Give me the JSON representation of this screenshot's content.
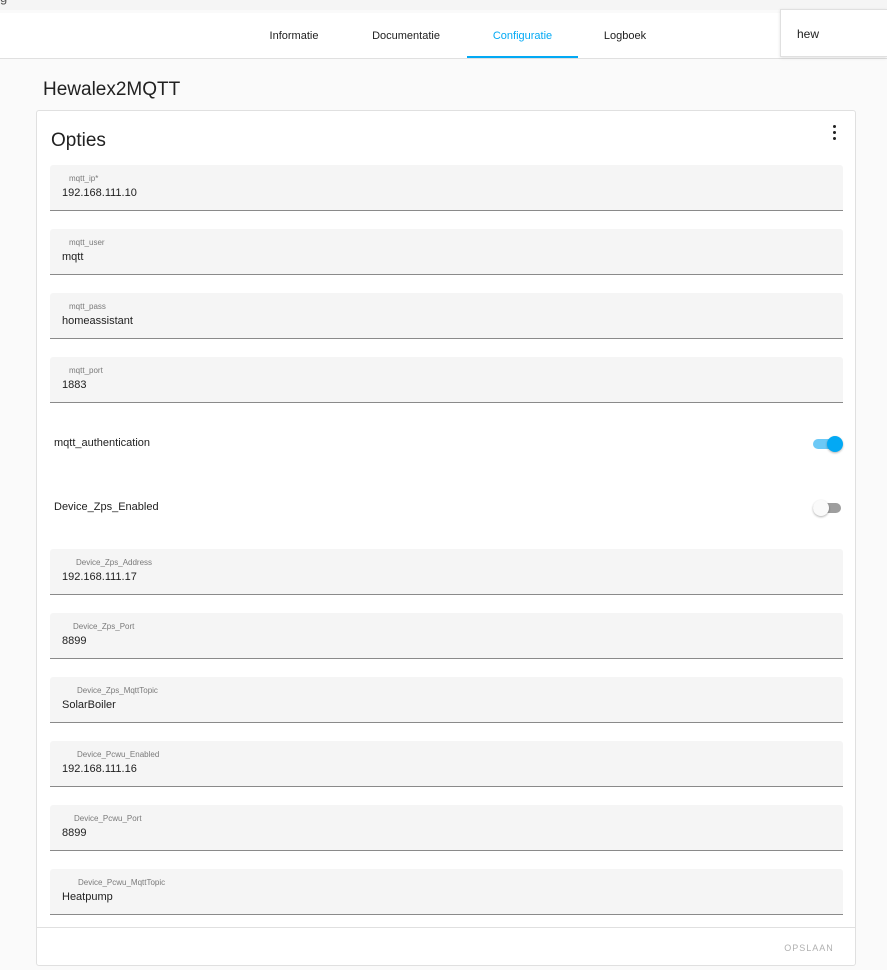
{
  "top_strip": {
    "glyph": "g"
  },
  "tabs": [
    {
      "label": "Informatie",
      "active": false
    },
    {
      "label": "Documentatie",
      "active": false
    },
    {
      "label": "Configuratie",
      "active": true
    },
    {
      "label": "Logboek",
      "active": false
    }
  ],
  "search": {
    "value": "hew"
  },
  "page": {
    "title": "Hewalex2MQTT"
  },
  "card": {
    "title": "Opties",
    "menu_icon": "dots-vertical-icon",
    "save_label": "OPSLAAN"
  },
  "fields": [
    {
      "label": "mqtt_ip*",
      "value": "192.168.111.10"
    },
    {
      "label": "mqtt_user",
      "value": "mqtt"
    },
    {
      "label": "mqtt_pass",
      "value": "homeassistant"
    },
    {
      "label": "mqtt_port",
      "value": "1883"
    },
    {
      "label": "Device_Zps_Address",
      "value": "192.168.111.17"
    },
    {
      "label": "Device_Zps_Port",
      "value": "8899"
    },
    {
      "label": "Device_Zps_MqttTopic",
      "value": "SolarBoiler"
    },
    {
      "label": "Device_Pcwu_Enabled",
      "value": "192.168.111.16"
    },
    {
      "label": "Device_Pcwu_Port",
      "value": "8899"
    },
    {
      "label": "Device_Pcwu_MqttTopic",
      "value": "Heatpump"
    }
  ],
  "toggles": [
    {
      "label": "mqtt_authentication",
      "on": true
    },
    {
      "label": "Device_Zps_Enabled",
      "on": false
    }
  ],
  "colors": {
    "accent": "#03a9f4",
    "field_bg": "#f5f5f5"
  }
}
